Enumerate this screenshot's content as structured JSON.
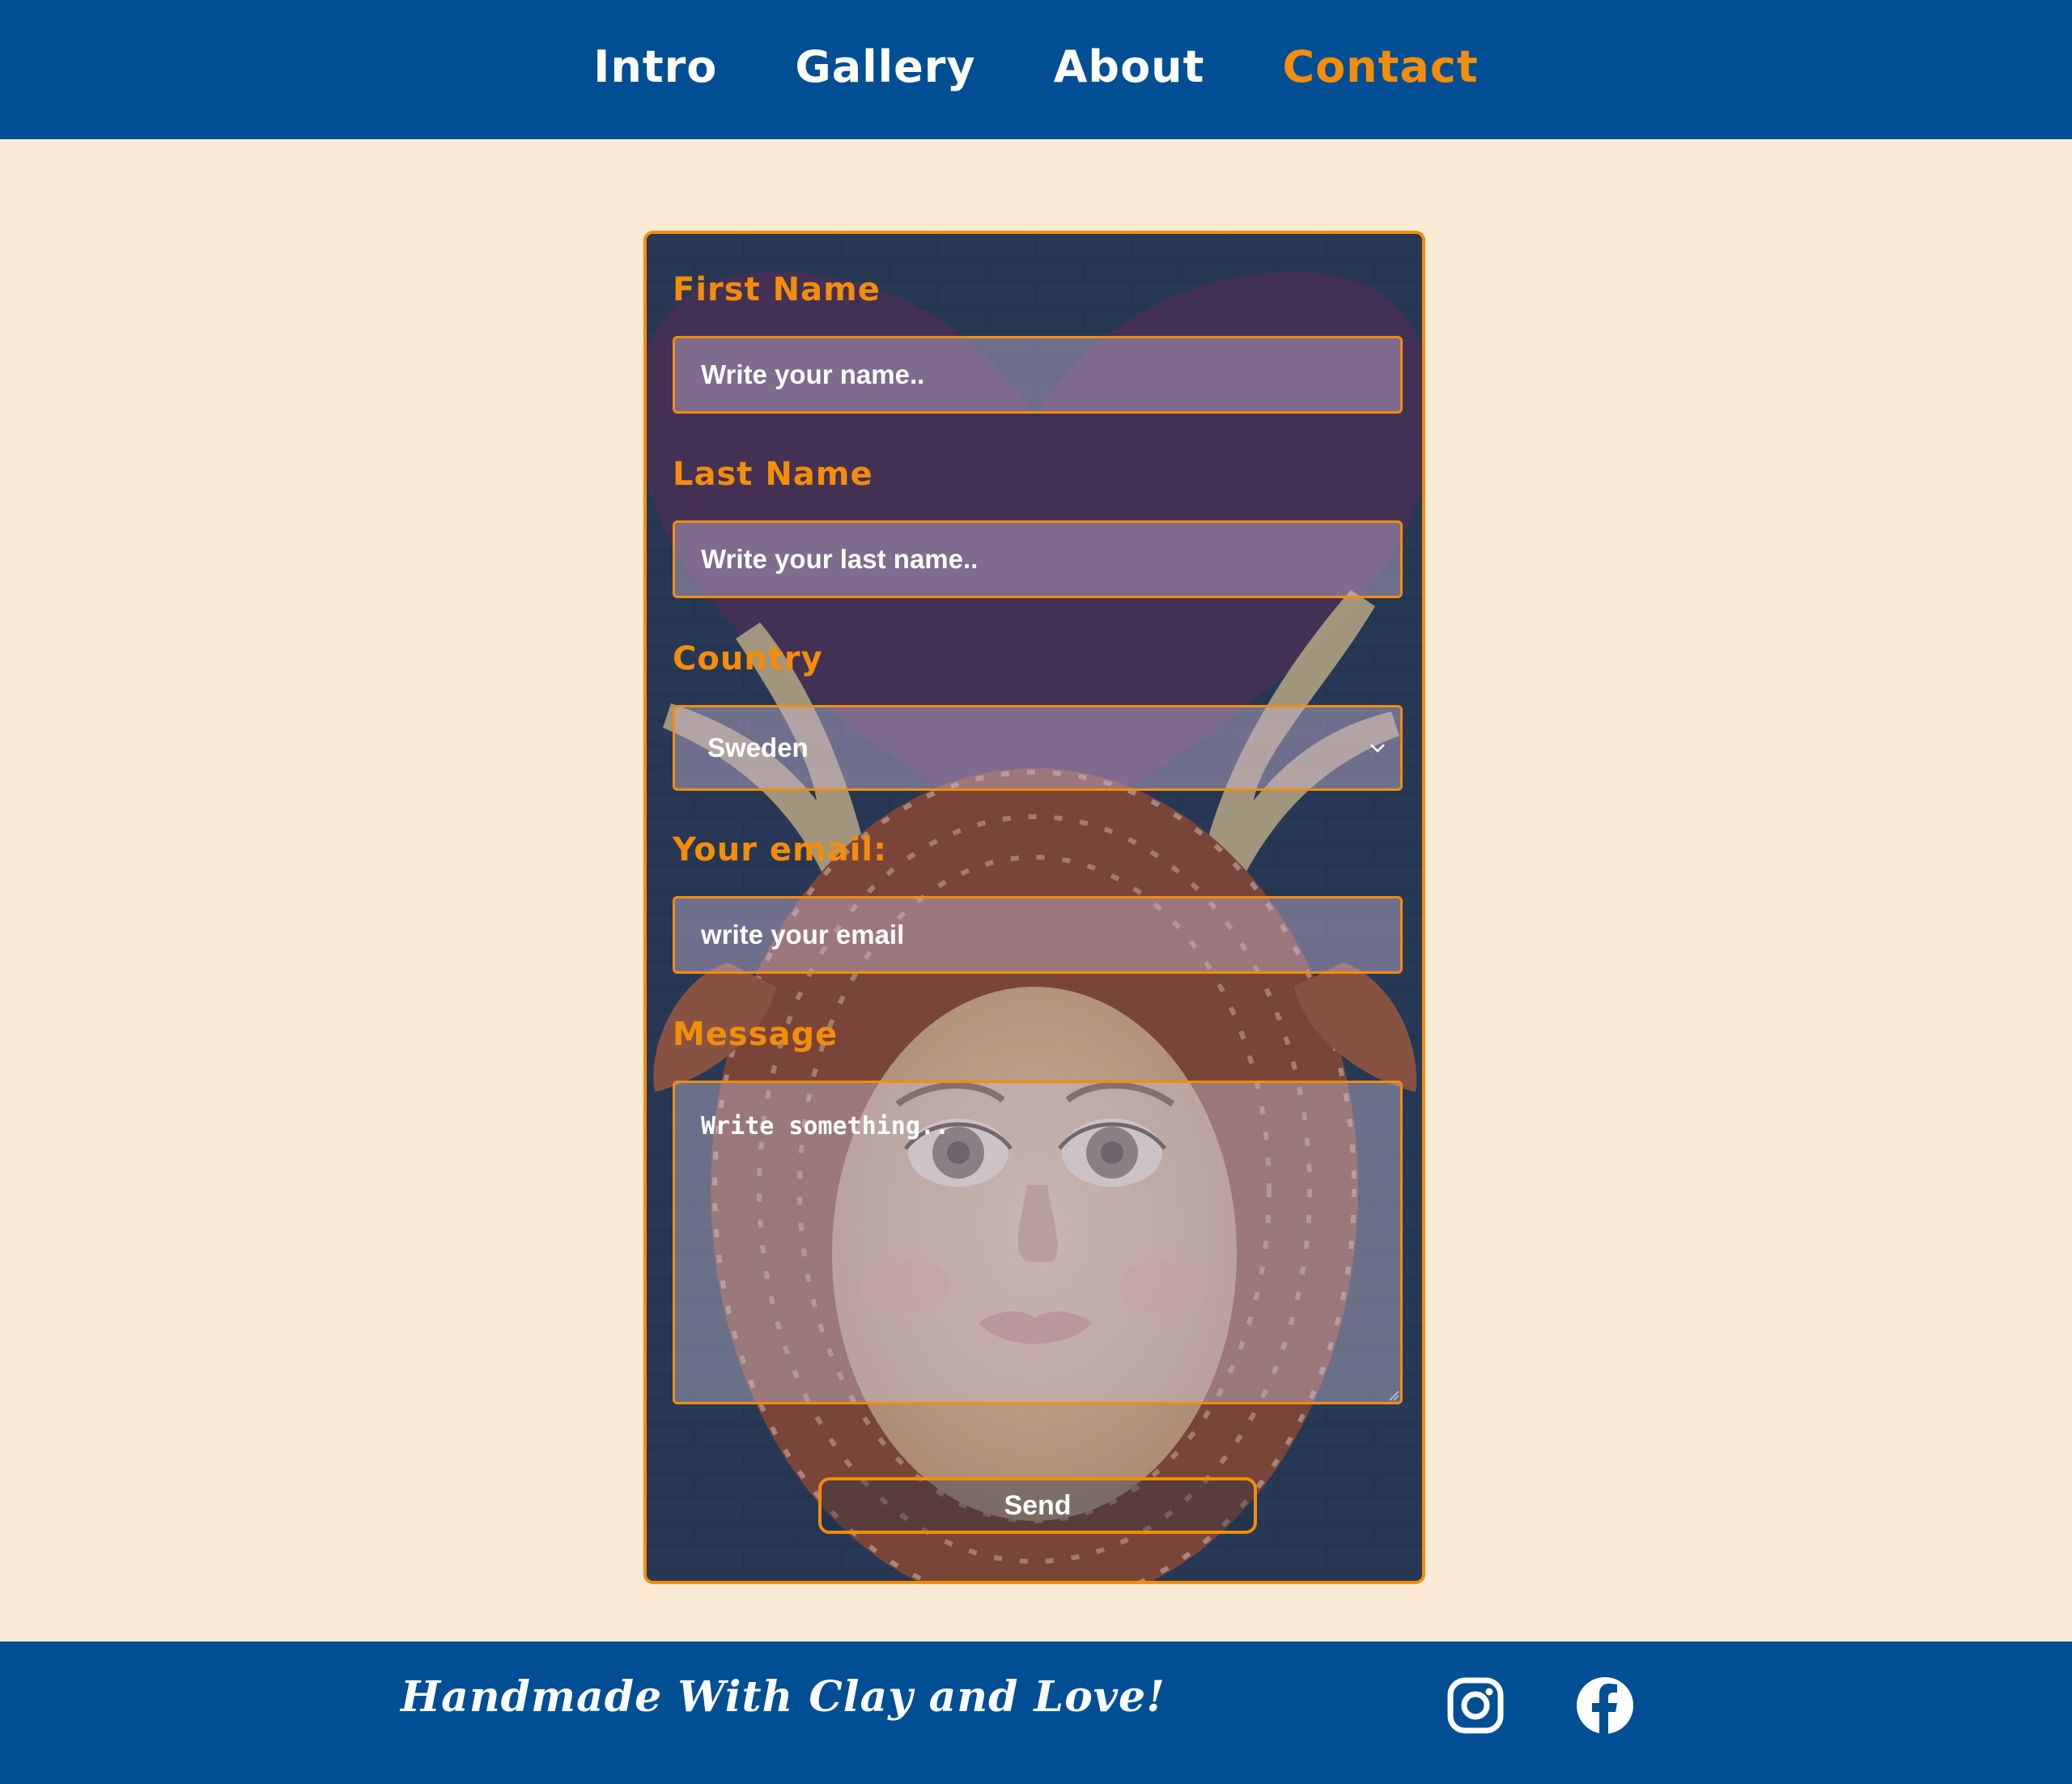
{
  "nav": {
    "items": [
      {
        "label": "Intro",
        "active": false
      },
      {
        "label": "Gallery",
        "active": false
      },
      {
        "label": "About",
        "active": false
      },
      {
        "label": "Contact",
        "active": true
      }
    ]
  },
  "form": {
    "first_name": {
      "label": "First Name",
      "placeholder": "Write your name.."
    },
    "last_name": {
      "label": "Last Name",
      "placeholder": "Write your last name.."
    },
    "country": {
      "label": "Country",
      "selected": "Sweden"
    },
    "email": {
      "label": "Your email:",
      "placeholder": "write your email"
    },
    "message": {
      "label": "Message",
      "placeholder": "Write something.."
    },
    "send_label": "Send"
  },
  "footer": {
    "tagline": "Handmade With Clay and Love!",
    "social": [
      {
        "icon": "instagram-icon"
      },
      {
        "icon": "facebook-icon"
      }
    ]
  },
  "colors": {
    "nav_bg": "#004e93",
    "accent": "#f48d09",
    "page_bg": "#faead6"
  }
}
